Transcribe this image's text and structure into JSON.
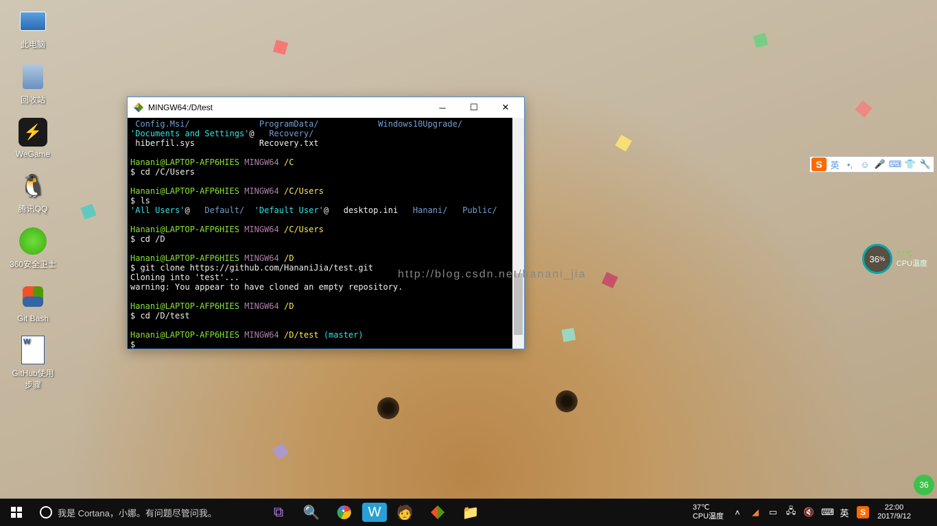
{
  "desktop": {
    "icons": [
      {
        "name": "this-pc",
        "label": "此电脑"
      },
      {
        "name": "recycle-bin",
        "label": "回收站"
      },
      {
        "name": "wegame",
        "label": "WeGame"
      },
      {
        "name": "qq",
        "label": "腾讯QQ"
      },
      {
        "name": "360-security",
        "label": "360安全卫士"
      },
      {
        "name": "git-bash",
        "label": "Git Bash"
      },
      {
        "name": "github-doc",
        "label": "GitHub使用\n步骤"
      }
    ]
  },
  "terminal": {
    "title": "MINGW64:/D/test",
    "user": "Hanani@LAPTOP-AFP6HIES",
    "shell": "MINGW64",
    "lines": {
      "l1a": " Config.Msi/",
      "l1b": "ProgramData/",
      "l1c": "Windows10Upgrade/",
      "l2a": "'Documents and Settings'",
      "l2at": "@",
      "l2b": "Recovery/",
      "l3a": " hiberfil.sys",
      "l3b": "Recovery.txt",
      "p1": "/C",
      "c1": "$ cd /C/Users",
      "p2": "/C/Users",
      "c2": "$ ls",
      "u1": "'All Users'",
      "u1at": "@",
      "u2": "Default/",
      "u3": "'Default User'",
      "u3at": "@",
      "u4": "desktop.ini",
      "u5": "Hanani/",
      "u6": "Public/",
      "p3": "/C/Users",
      "c3": "$ cd /D",
      "p4": "/D",
      "c4": "$ git clone https://github.com/HananiJia/test.git",
      "o1": "Cloning into 'test'...",
      "o2": "warning: You appear to have cloned an empty repository.",
      "p5": "/D",
      "c5": "$ cd /D/test",
      "p6": "/D/test",
      "br": "(master)",
      "c6": "$"
    }
  },
  "watermark": "http://blog.csdn.net/hanani_jia",
  "ime": {
    "lang": "英"
  },
  "cpu": {
    "pct": "36",
    "pct_suffix": "%",
    "temp": "37℃",
    "label": "CPU温度"
  },
  "taskbar": {
    "cortana": "我是 Cortana，小娜。有问题尽管问我。",
    "temp_top": "37℃",
    "temp_bot": "CPU温度",
    "ime": "英",
    "clock_time": "22:00",
    "clock_date": "2017/9/12"
  }
}
